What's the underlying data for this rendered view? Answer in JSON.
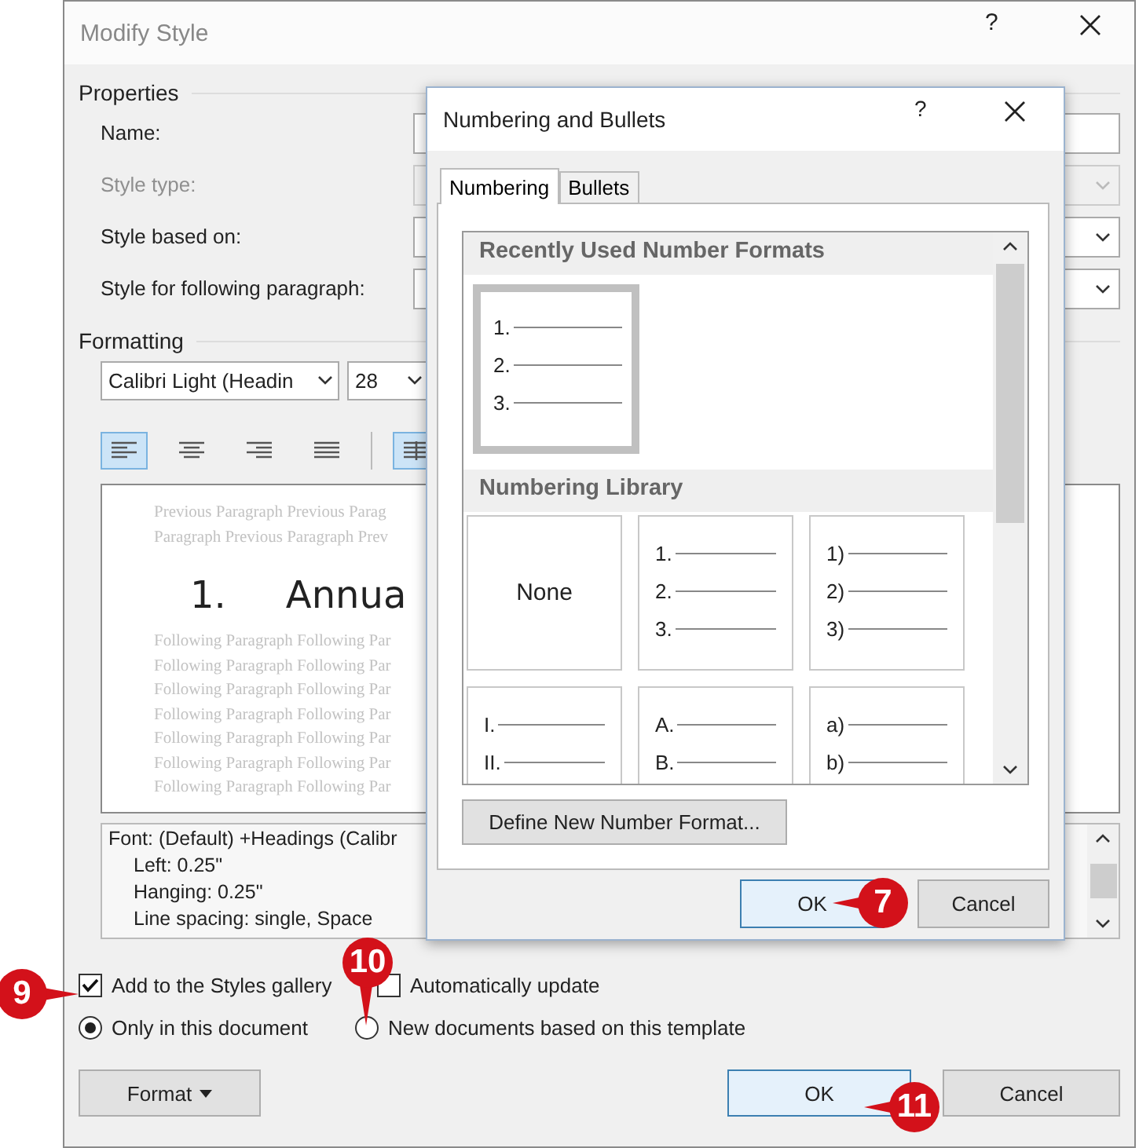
{
  "window": {
    "title": "Modify Style",
    "help": "?"
  },
  "properties": {
    "heading": "Properties",
    "fields": [
      {
        "label": "Name:",
        "kind": "text",
        "disabled": false
      },
      {
        "label": "Style type:",
        "kind": "dropdown",
        "disabled": true
      },
      {
        "label": "Style based on:",
        "kind": "dropdown",
        "disabled": false
      },
      {
        "label": "Style for following paragraph:",
        "kind": "dropdown",
        "disabled": false
      }
    ]
  },
  "formatting": {
    "heading": "Formatting",
    "font": "Calibri Light (Headin",
    "size": "28",
    "alignment": [
      {
        "kind": "left",
        "selected": true
      },
      {
        "kind": "center",
        "selected": false
      },
      {
        "kind": "right",
        "selected": false
      },
      {
        "kind": "justify",
        "selected": false
      },
      {
        "kind": "spacing",
        "selected": true
      }
    ],
    "preview": {
      "previous": [
        "Previous Paragraph Previous Parag",
        "Paragraph Previous Paragraph Prev"
      ],
      "number": "1.",
      "heading": "Annua",
      "following": [
        "Following Paragraph Following Par",
        "Following Paragraph Following Par",
        "Following Paragraph Following Par",
        "Following Paragraph Following Par",
        "Following Paragraph Following Par",
        "Following Paragraph Following Par",
        "Following Paragraph Following Par"
      ]
    },
    "description": [
      "Font: (Default) +Headings (Calibr",
      "Left:  0.25\"",
      "Hanging:  0.25\"",
      "Line spacing:  single, Space"
    ]
  },
  "options": {
    "add_to_gallery": {
      "label": "Add to the Styles gallery",
      "checked": true
    },
    "auto_update": {
      "label": "Automatically update",
      "checked": false
    },
    "scope": [
      {
        "label": "Only in this document",
        "selected": true
      },
      {
        "label": "New documents based on this template",
        "selected": false
      }
    ]
  },
  "buttons": {
    "format": "Format",
    "ok": "OK",
    "cancel": "Cancel"
  },
  "numbering_dialog": {
    "title": "Numbering and Bullets",
    "help": "?",
    "tabs": [
      {
        "label": "Numbering",
        "selected": true
      },
      {
        "label": "Bullets",
        "selected": false
      }
    ],
    "sections": [
      {
        "heading": "Recently Used Number Formats",
        "items": [
          {
            "kind": "list",
            "lines": [
              "1.",
              "2.",
              "3."
            ],
            "selected": true
          }
        ]
      },
      {
        "heading": "Numbering Library",
        "items": [
          {
            "kind": "none",
            "label": "None",
            "selected": false
          },
          {
            "kind": "list",
            "lines": [
              "1.",
              "2.",
              "3."
            ],
            "selected": false
          },
          {
            "kind": "list",
            "lines": [
              "1)",
              "2)",
              "3)"
            ],
            "selected": false
          },
          {
            "kind": "list",
            "lines": [
              "I.",
              "II."
            ],
            "selected": false
          },
          {
            "kind": "list",
            "lines": [
              "A.",
              "B."
            ],
            "selected": false
          },
          {
            "kind": "list",
            "lines": [
              "a)",
              "b)"
            ],
            "selected": false
          }
        ]
      }
    ],
    "define_button": "Define New Number Format...",
    "ok": "OK",
    "cancel": "Cancel"
  },
  "callouts": [
    {
      "number": "7"
    },
    {
      "number": "9"
    },
    {
      "number": "10"
    },
    {
      "number": "11"
    }
  ]
}
